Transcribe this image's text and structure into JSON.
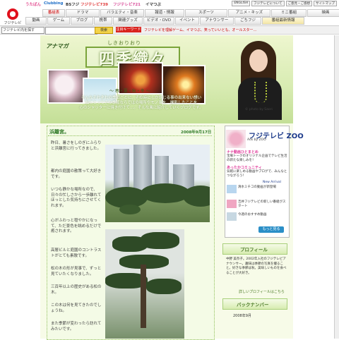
{
  "header": {
    "logo_text": "フジテレビ",
    "mini_logos": [
      "うたばん",
      "Clubbing",
      "BSフジ",
      "フジテレビ739",
      "フジテレビ721",
      "フジテレビ CSHD",
      "イマつぶ"
    ],
    "top_links": [
      "ENGLISH",
      "フジテレビについて",
      "ご意見・ご感想",
      "サイトマップ"
    ],
    "tabs_row1": [
      "番組表",
      "ドラマ",
      "バラエティ・音楽",
      "報道・情報",
      "スポーツ",
      "アニメ・キッズ",
      "ミニ番組",
      "映画"
    ],
    "tabs_row2": [
      "動画",
      "ゲーム",
      "ブログ",
      "携帯",
      "関連グッズ",
      "ビデオ・DVD",
      "イベント",
      "アナウンサー",
      "ごちフジ",
      "番組最新情報"
    ]
  },
  "search": {
    "select_value": "フジテレビ内を探す",
    "button_label": "検索",
    "keyword_label": "注目キーワード",
    "keywords": "フジテレビを理解ゲーム、イマつぶ、笑っていいとも、オールスター…"
  },
  "banner": {
    "brand": "アナマガ",
    "title_ruby": "しきおりおり",
    "title": "四季織々",
    "seasons": "〜 春・夏・秋・冬 〜",
    "tagline_line1": "そんなそれぞれの季節ごとに、その時にしか感じる事の出来ない想い",
    "tagline_line2": "私にとってその季節ならではの場所やモノ事を、撮影したことを",
    "tagline_line3": "心のシャッターに焼き付けて…。そんな風に紹介していくブログです。",
    "photo_credit": "© photo by Saori"
  },
  "post": {
    "title": "浜離宮。",
    "date": "2008年9月17日",
    "paragraphs": [
      "昨日、暑さをしのぎにふらりと浜離宮に行ってきました。",
      "都内の庭園の散策って大好きです。",
      "いつも静かな場所なので、日々の忙しさから一歩離れてほっとした気持ちにさせてくれます。",
      "心がふわっと穏やかになって、ただ景色を眺めるだけで癒されます。",
      "高層ビルと庭園のコントラストがとても素敵です。",
      "松の木の形が見事で、ずっと見ていたくなりました。",
      "三百年以上の歴史がある松の木。",
      "この木は何を見てきたのでしょうね。",
      "また季節が変わったら訪れてみたいです。"
    ]
  },
  "sidebar": {
    "zoo_title": "フジテレビ ZOO",
    "zoo_small": "Ads by ZOO",
    "zoo_label": "ナナ動画ひとまとめ",
    "zoo_desc": "宝塚トークのオリジナル企画でテレビ生活の新たな楽しみを！",
    "zoo_sub": "あったかコミュニティ",
    "zoo_desc2": "気軽に楽しめる動画やブログで、みんなとつながろう！",
    "new_arrival": "New Arrival",
    "items": [
      "清水ミチコの動画が新登場",
      "吉井フジテレビの新しい番組がスタート",
      "今週のおすすめ動画"
    ],
    "more_button": "もっと見る",
    "profile_title": "プロフィール",
    "profile_text": "中野 美奈子。2002年入社のフジテレビアナウンサー。趣味は季節の写真を撮ること。好きな季節は秋。美味しいものを食べることが大好き。",
    "profile_link": "詳しいプロフィールはこちら",
    "back_title": "バックナンバー",
    "back_text": "2008年9月"
  }
}
